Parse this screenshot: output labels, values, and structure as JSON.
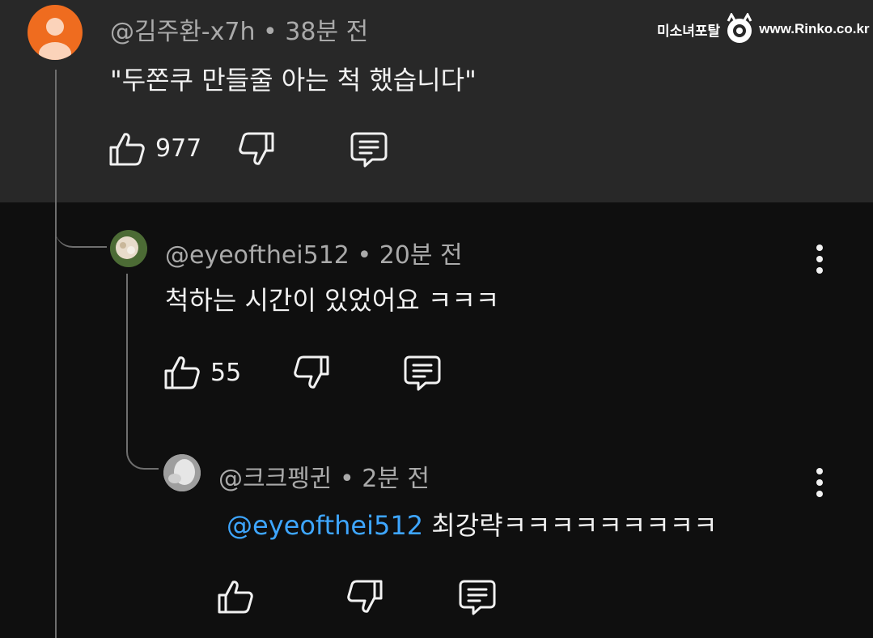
{
  "watermark": {
    "brand": "미소녀포탈",
    "site": "www.Rinko.co.kr"
  },
  "comment": {
    "author": "@김주환-x7h",
    "time": "38분 전",
    "text": "\"두쫀쿠 만들줄 아는 척 했습니다\"",
    "likes": "977",
    "avatar_color": "#ef6c1f"
  },
  "reply1": {
    "author": "@eyeofthei512",
    "time": "20분 전",
    "text": "척하는 시간이 있었어요 ㅋㅋㅋ",
    "likes": "55"
  },
  "reply2": {
    "author": "@크크펭귄",
    "time": "2분 전",
    "mention": "@eyeofthei512",
    "text": "최강략ㅋㅋㅋㅋㅋㅋㅋㅋㅋ"
  },
  "separator": "•",
  "icons": [
    "like-icon",
    "dislike-icon",
    "reply-icon",
    "more-options-icon"
  ],
  "colors": {
    "background": "#0f0f0f",
    "highlight": "#282828",
    "mention": "#3ea6ff",
    "meta": "#aaaaaa"
  }
}
